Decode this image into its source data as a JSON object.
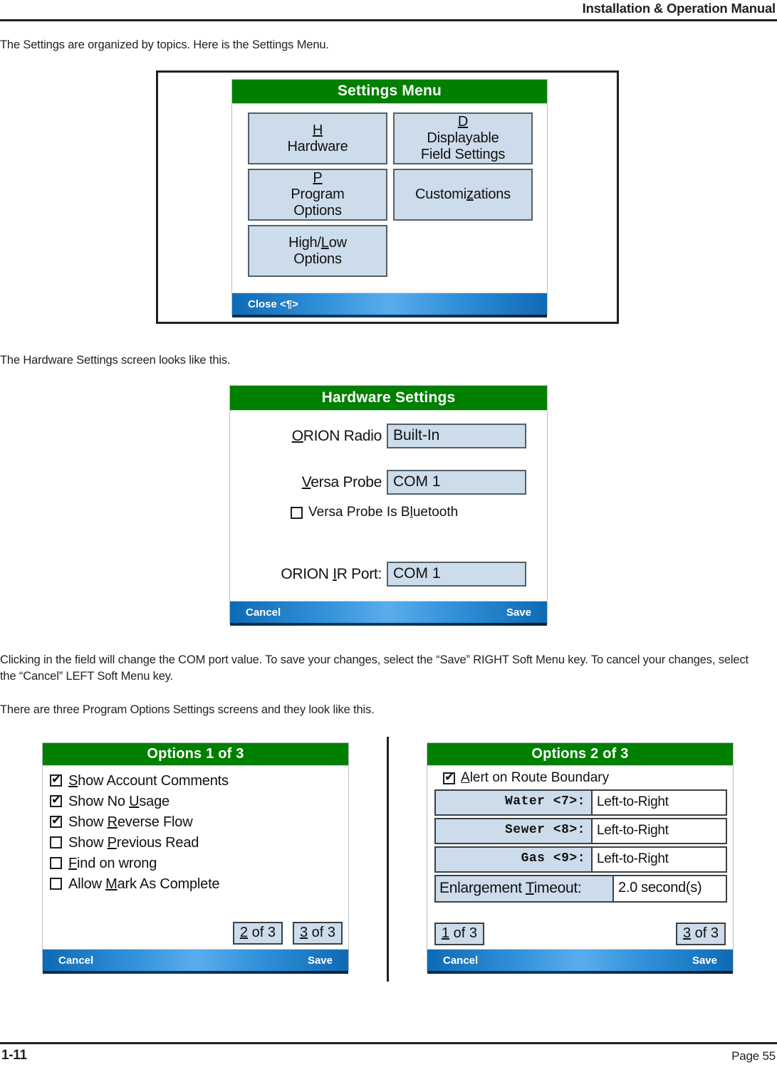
{
  "header": {
    "title": "Installation & Operation Manual"
  },
  "paragraphs": {
    "p1": "The Settings are organized by topics.  Here is the Settings Menu.",
    "p2": "The Hardware Settings screen looks like this.",
    "p3": "Clicking in the field will change the COM port value.  To save your changes, select the “Save” RIGHT Soft Menu key.  To cancel your changes, select the “Cancel” LEFT Soft Menu key.",
    "p4": "There are three Program Options Settings screens and they look like this."
  },
  "settings_menu": {
    "title": "Settings Menu",
    "buttons": [
      {
        "id": "hardware",
        "line1": "Hardware",
        "line2": "",
        "accel": "H"
      },
      {
        "id": "displayable",
        "line1": "Displayable",
        "line2": "Field Settings",
        "accel": "D"
      },
      {
        "id": "program-options",
        "line1": "Program",
        "line2": "Options",
        "accel": "P"
      },
      {
        "id": "customizations",
        "line1": "Customizations",
        "line2": "",
        "accel": "z"
      },
      {
        "id": "high-low",
        "line1": "High/Low",
        "line2": "Options",
        "accel": "L"
      }
    ],
    "footer_left": "Close <¶>"
  },
  "hardware_settings": {
    "title": "Hardware Settings",
    "fields": [
      {
        "label": "ORION Radio",
        "value": "Built-In"
      },
      {
        "label": "Versa Probe",
        "value": "COM 1"
      },
      {
        "label": "ORION IR Port:",
        "value": "COM 1"
      }
    ],
    "checkbox": {
      "label": "Versa Probe Is Bluetooth",
      "checked": false
    },
    "footer_left": "Cancel",
    "footer_right": "Save"
  },
  "options_1": {
    "title": "Options 1 of 3",
    "items": [
      {
        "label": "Show Account Comments",
        "checked": true
      },
      {
        "label": "Show No Usage",
        "checked": true
      },
      {
        "label": "Show Reverse Flow",
        "checked": true
      },
      {
        "label": "Show Previous Read",
        "checked": false
      },
      {
        "label": "Find on wrong",
        "checked": false
      },
      {
        "label": "Allow Mark As Complete",
        "checked": false
      }
    ],
    "pager": [
      "2 of 3",
      "3 of 3"
    ],
    "footer_left": "Cancel",
    "footer_right": "Save"
  },
  "options_2": {
    "title": "Options 2 of 3",
    "checkbox": {
      "label": "Alert on Route Boundary",
      "checked": true
    },
    "rows": [
      {
        "key": "Water <7>:",
        "value": "Left-to-Right"
      },
      {
        "key": "Sewer <8>:",
        "value": "Left-to-Right"
      },
      {
        "key": "Gas <9>:",
        "value": "Left-to-Right"
      }
    ],
    "timeout_row": {
      "key": "Enlargement Timeout:",
      "value": "2.0 second(s)"
    },
    "pager": [
      "1 of 3",
      "3 of 3"
    ],
    "footer_left": "Cancel",
    "footer_right": "Save"
  },
  "footer": {
    "left": "1-11",
    "right": "Page 55"
  },
  "colors": {
    "title_green": "#008000",
    "footer_blue": "#2f8fd8",
    "button_fill": "#ccdcea",
    "ink": "#231f20"
  }
}
